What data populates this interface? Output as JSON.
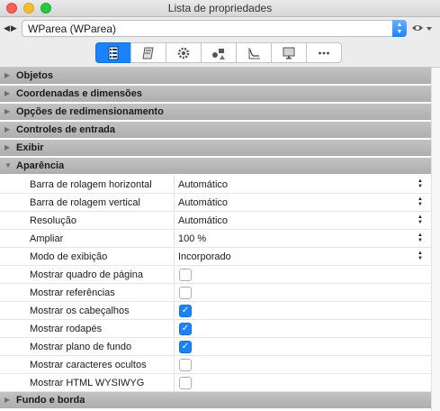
{
  "window": {
    "title": "Lista de propriedades"
  },
  "object_selector": {
    "nav": "◀▶",
    "value": "WParea (WParea)"
  },
  "toolbar": {
    "tabs": [
      {
        "icon": "properties-list-icon",
        "active": true
      },
      {
        "icon": "book-icon",
        "active": false
      },
      {
        "icon": "gear-icon",
        "active": false
      },
      {
        "icon": "shapes-icon",
        "active": false
      },
      {
        "icon": "chart-icon",
        "active": false
      },
      {
        "icon": "monitor-icon",
        "active": false
      },
      {
        "icon": "more-icon",
        "active": false
      }
    ]
  },
  "categories": {
    "objetos": "Objetos",
    "coordenadas": "Coordenadas e dimensões",
    "redimensionamento": "Opções de redimensionamento",
    "controles": "Controles de entrada",
    "exibir": "Exibir",
    "aparencia": "Aparência",
    "fundo": "Fundo e borda"
  },
  "properties": [
    {
      "name": "Barra de rolagem horizontal",
      "value": "Automático"
    },
    {
      "name": "Barra de rolagem vertical",
      "value": "Automático"
    },
    {
      "name": "Resolução",
      "value": "Automático"
    },
    {
      "name": "Ampliar",
      "value": "100 %"
    },
    {
      "name": "Modo de exibição",
      "value": "Incorporado"
    },
    {
      "name": "Mostrar quadro de página",
      "checked": false
    },
    {
      "name": "Mostrar referências",
      "checked": false
    },
    {
      "name": "Mostrar os cabeçalhos",
      "checked": true
    },
    {
      "name": "Mostrar rodapés",
      "checked": true
    },
    {
      "name": "Mostrar plano de fundo",
      "checked": true
    },
    {
      "name": "Mostrar caracteres ocultos",
      "checked": false
    },
    {
      "name": "Mostrar HTML WYSIWYG",
      "checked": false
    }
  ],
  "colors": {
    "accent": "#1a82fb",
    "category_bg": "#b8b8b8"
  }
}
